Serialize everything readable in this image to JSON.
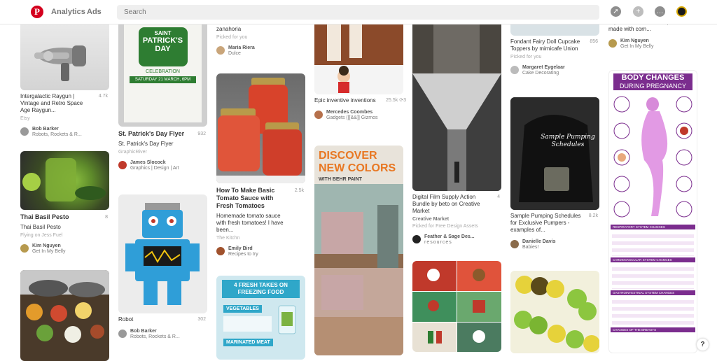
{
  "header": {
    "nav_analytics": "Analytics",
    "nav_ads": "Ads",
    "search_placeholder": "Search"
  },
  "pins": {
    "raygun": {
      "desc": "Intergalactic Raygun | Vintage and Retro Space Age Raygun...",
      "saves": "4.7k",
      "source": "Etsy",
      "user": "Bob Barker",
      "board": "Robots, Rockets & R..."
    },
    "pesto": {
      "title": "Thai Basil Pesto",
      "desc": "Thai Basil Pesto",
      "saves": "8",
      "source": "Flying on Jess Fuel",
      "user": "Kim Nguyen",
      "board": "Get In My Belly"
    },
    "stpatrick": {
      "title": "St. Patrick's Day Flyer",
      "desc": "St. Patrick's Day Flyer",
      "saves": "932",
      "source": "GraphicRiver",
      "user": "James Slocock",
      "board": "Graphics | Design | Art",
      "img_line1": "SAINT",
      "img_line2": "PATRICK'S",
      "img_line3": "DAY",
      "img_line4": "CELEBRATION",
      "img_line5": "SATURDAY 21 MARCH, 6PM"
    },
    "robot": {
      "desc": "Robot",
      "saves": "302",
      "user": "Bob Barker",
      "board": "Robots, Rockets & R..."
    },
    "col3top": {
      "desc": "Receta sacecito de zanahoria",
      "source": "Picked for you",
      "user": "Maria Riera",
      "board": "Dulce"
    },
    "tomato": {
      "title": "How To Make Basic Tomato Sauce with Fresh Tomatoes",
      "desc": "Homemade tomato sauce with fresh tomatoes! I have been...",
      "saves": "2.5k",
      "source": "The Kitchn",
      "user": "Emily Bird",
      "board": "Recipes to try"
    },
    "freezing": {
      "img_head": "4 FRESH TAKES ON FREEZING FOOD",
      "img_veg": "VEGETABLES",
      "img_meat": "MARINATED MEAT"
    },
    "inventive": {
      "desc": "Epic inventive inventions",
      "saves": "25.5k",
      "comments": "3",
      "user": "Mercedes Coombes",
      "board": "Gadgets ([[&&]] Gizmos"
    },
    "behr": {
      "img_line1": "DISCOVER",
      "img_line2": "NEW COLORS",
      "img_line3": "WITH BEHR PAINT"
    },
    "film": {
      "desc": "Digital Film Supply Action Bundle by beto on Creative Market",
      "saves": "4",
      "source": "Creative Market",
      "picked": "Picked for Free Design Assets",
      "user": "Feather & Sage Des...",
      "board": "resources"
    },
    "fondant": {
      "desc": "Fondant Fairy Doll Cupcake Toppers by mimicafe Union",
      "saves": "856",
      "source": "Picked for you",
      "user": "Margaret Eygelaar",
      "board": "Cake Decorating"
    },
    "pumping": {
      "desc": "Sample Pumping Schedules for Exclusive Pumpers - examples of...",
      "saves": "8.2k",
      "user": "Danielle Davis",
      "board": "Babies!",
      "img_text": "Sample Pumping Schedules"
    },
    "casserole": {
      "desc": "Squash Casserole Recipe made with corn...",
      "user": "Kim Nguyen",
      "board": "Get In My Belly"
    },
    "pregnancy": {
      "img_title": "BODY CHANGES",
      "img_sub": "DURING PREGNANCY",
      "s1": "RESPIRATORY SYSTEM CHANGES",
      "s2": "CARDIOVASCULAR SYSTEM CHANGES",
      "s3": "GASTROINTESTINAL SYSTEM CHANGES",
      "s4": "CHANGES OF THE BREASTS"
    }
  },
  "help": "?",
  "colors": {
    "brand": "#d4001e",
    "pregnancy": "#7b2d8e"
  }
}
